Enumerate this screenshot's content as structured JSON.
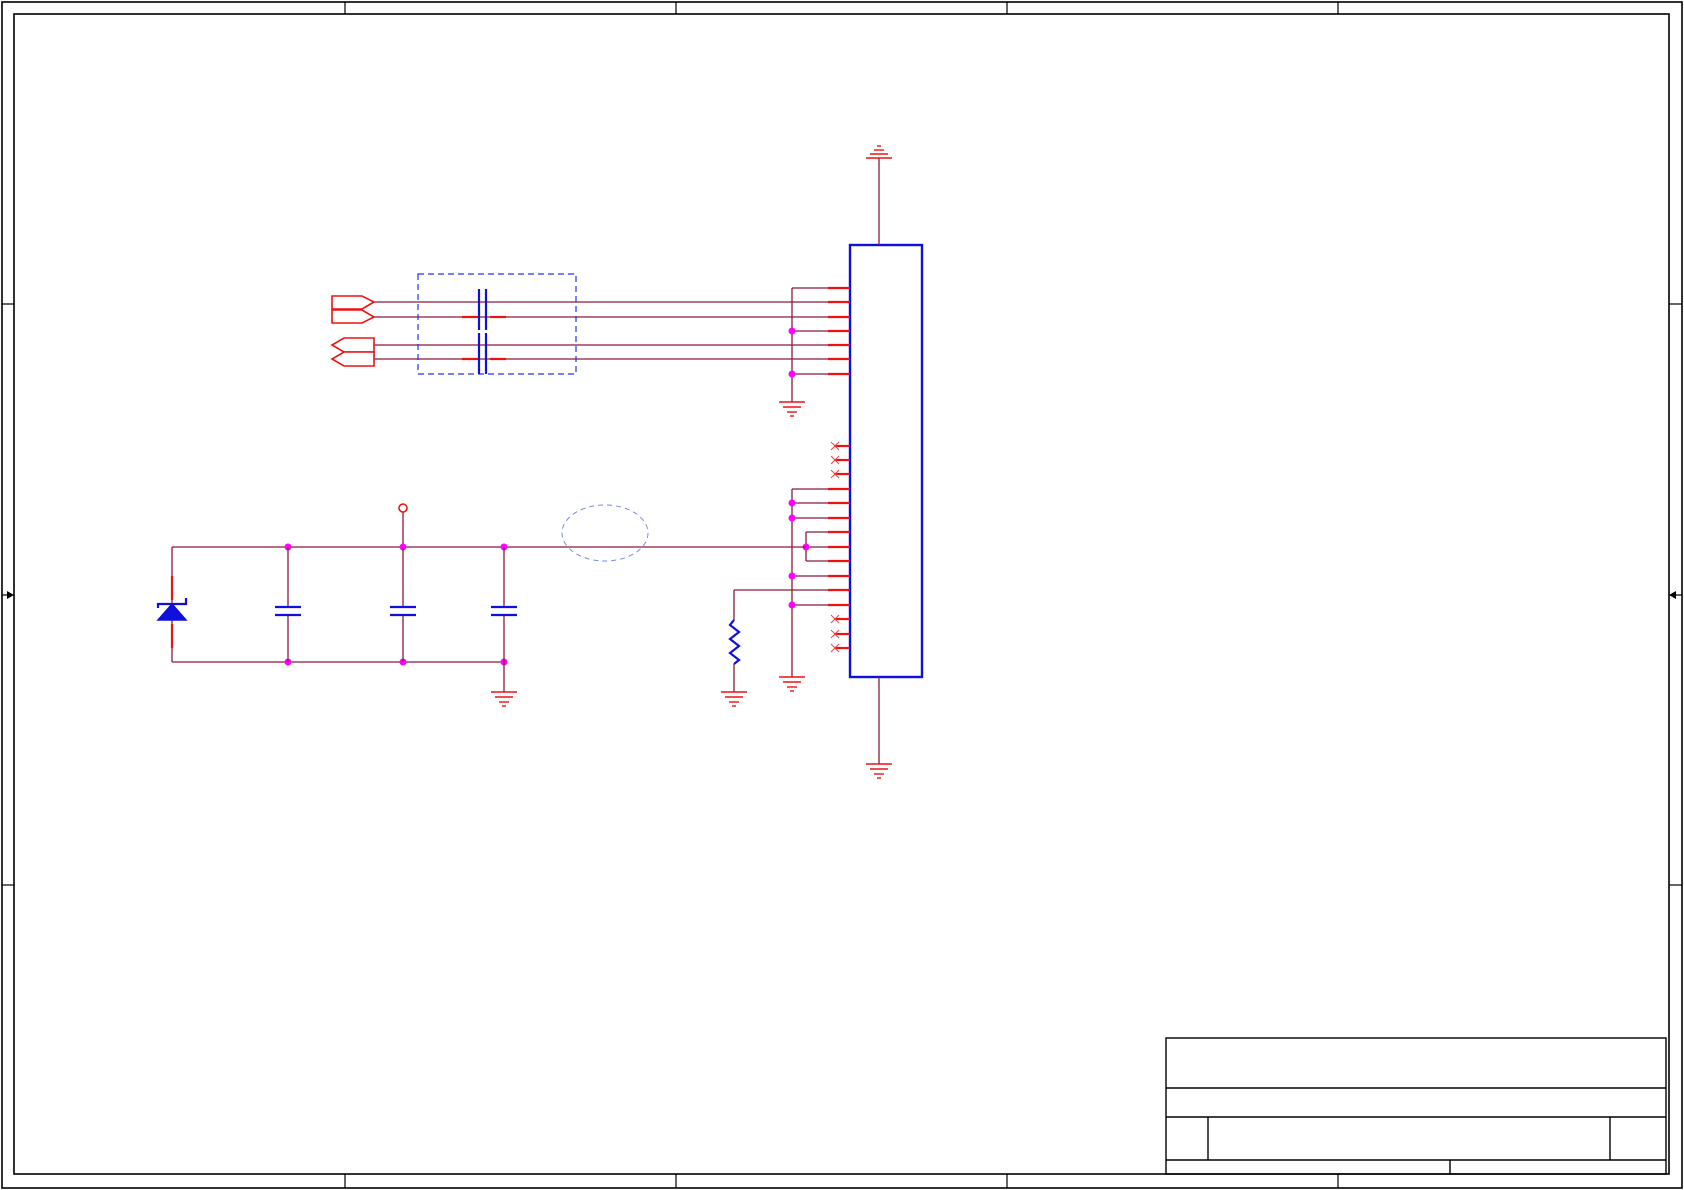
{
  "sheet": {
    "kind": "schematic",
    "colors": {
      "wire": "#8b1a3a",
      "pin": "#ee1111",
      "component": "#1010dd",
      "junction": "#ff00ff",
      "frame": "#000000"
    }
  },
  "components": [
    {
      "id": "connector",
      "kind": "ic-connector-block",
      "icon": "rectangle-block"
    },
    {
      "id": "common-mode-choke",
      "kind": "dashed-group",
      "icon": "capacitor-pair"
    },
    {
      "id": "tvs-diode",
      "kind": "zener-diode",
      "icon": "diode-icon"
    },
    {
      "id": "c-1",
      "kind": "capacitor",
      "icon": "capacitor-icon"
    },
    {
      "id": "c-2",
      "kind": "capacitor",
      "icon": "capacitor-icon"
    },
    {
      "id": "c-3",
      "kind": "capacitor",
      "icon": "capacitor-icon"
    },
    {
      "id": "r-1",
      "kind": "resistor",
      "icon": "resistor-icon"
    }
  ],
  "ports": [
    {
      "id": "out-port-1",
      "direction": "output"
    },
    {
      "id": "out-port-2",
      "direction": "output"
    },
    {
      "id": "in-port-1",
      "direction": "input"
    },
    {
      "id": "in-port-2",
      "direction": "input"
    }
  ]
}
